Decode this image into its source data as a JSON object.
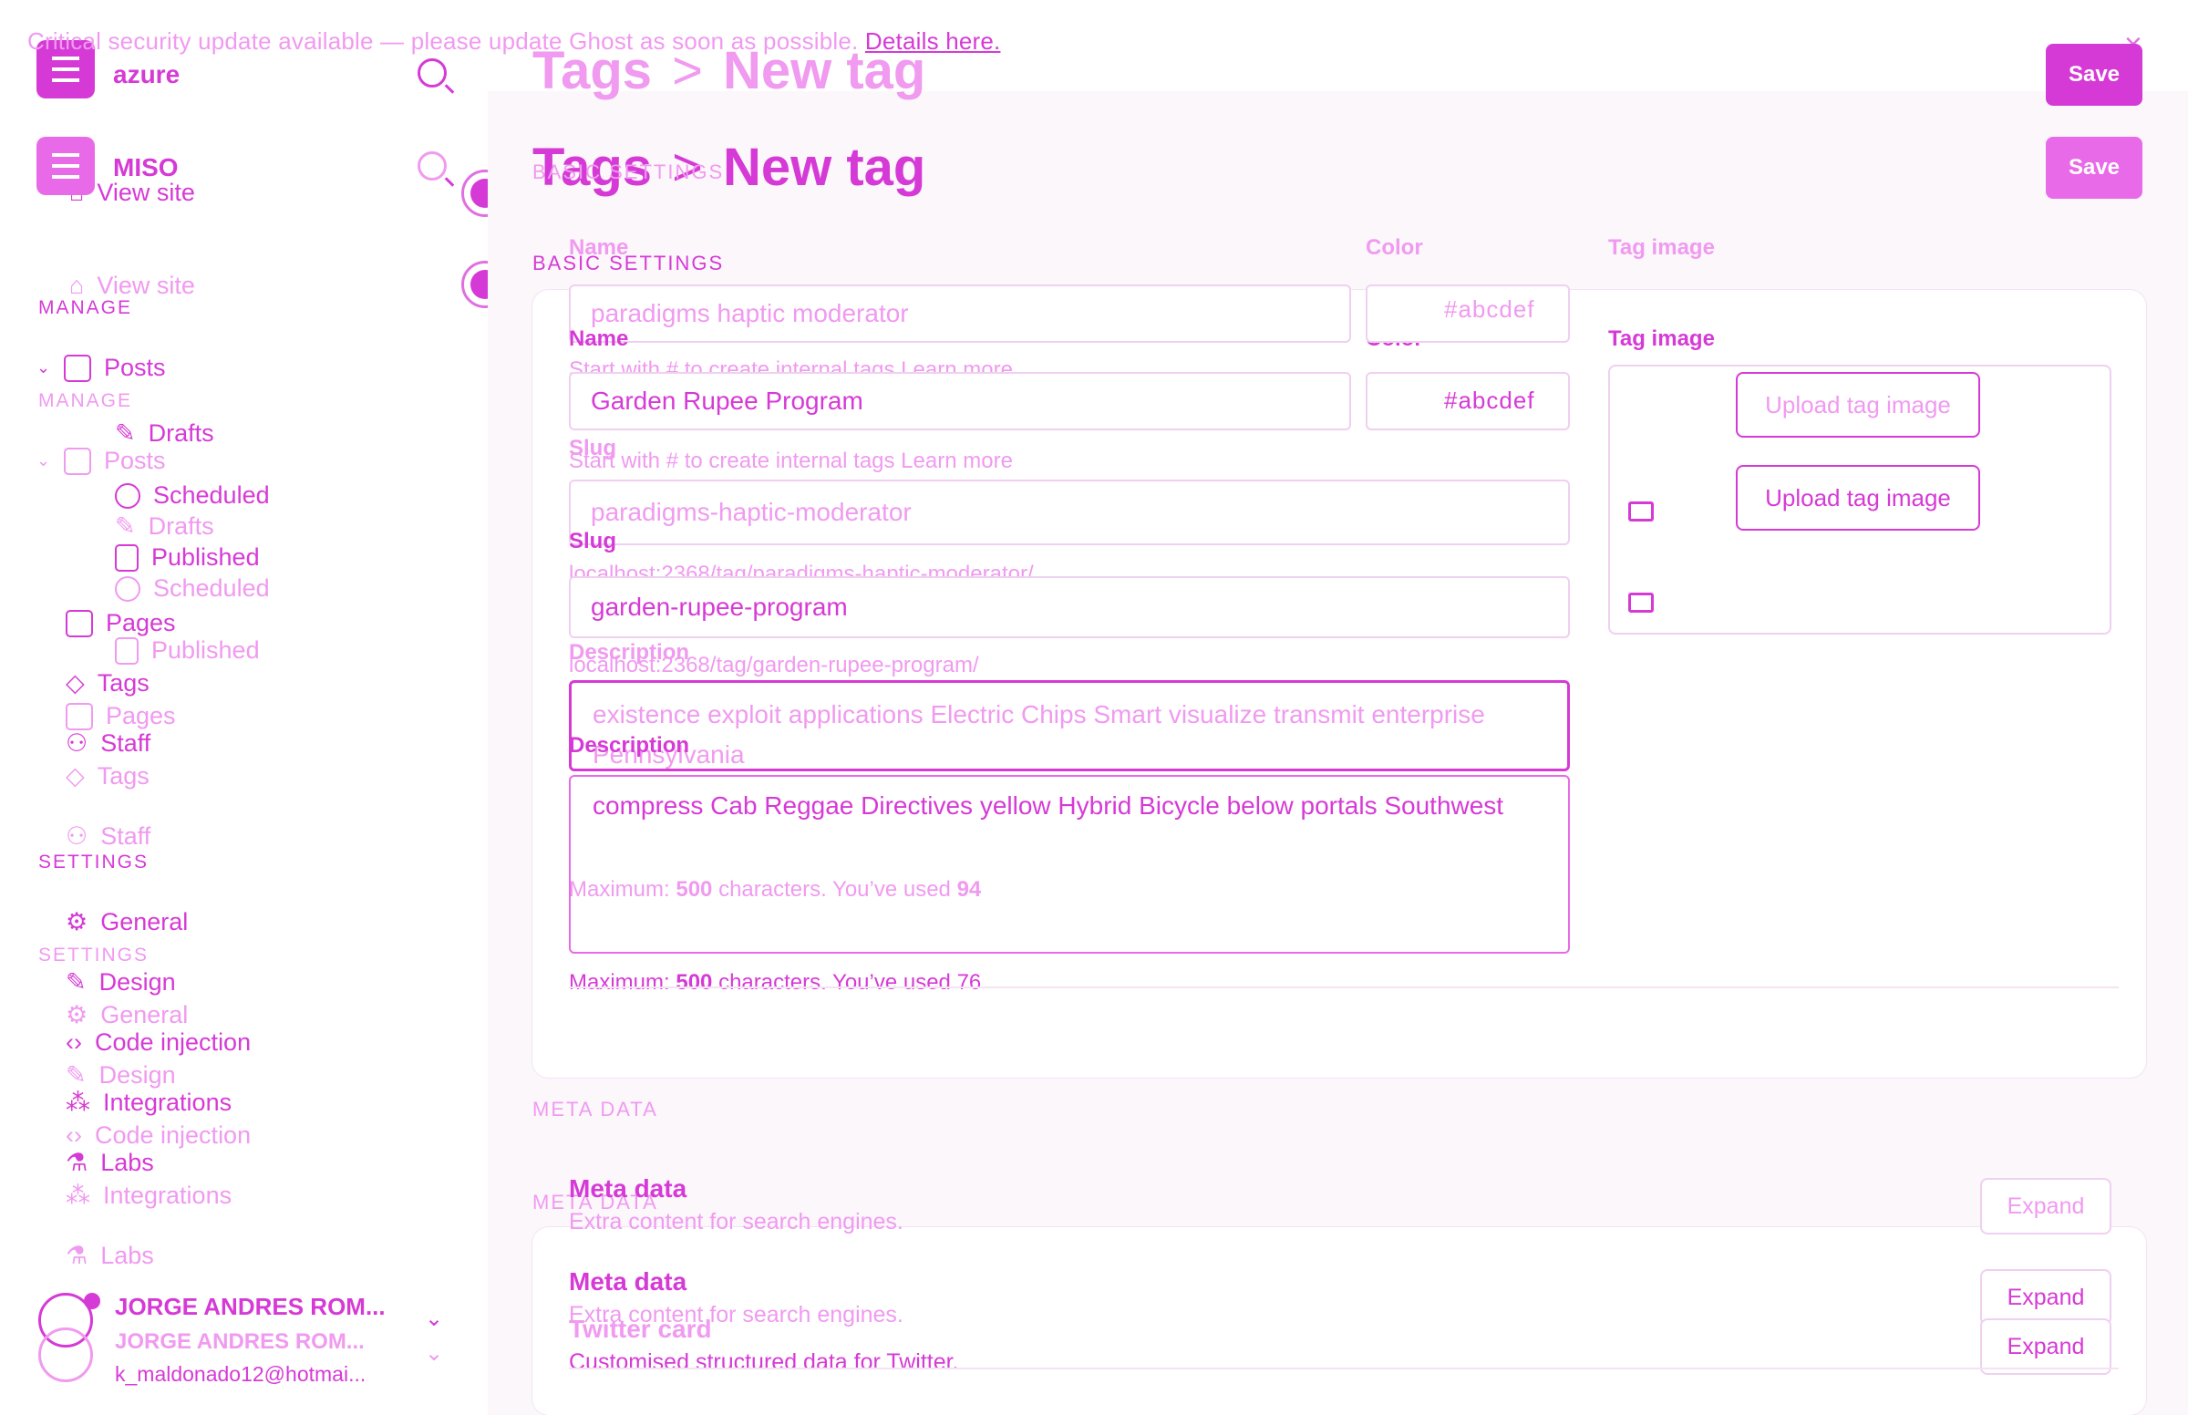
{
  "banner": {
    "text": "Critical security update available — please update Ghost as soon as possible.",
    "link": "Details here.",
    "close": "×"
  },
  "sidebar": {
    "brand_a": "azure",
    "brand_b": "MISO",
    "view_site": "View site",
    "manage_heading": "MANAGE",
    "settings_heading": "SETTINGS",
    "nav": {
      "posts": "Posts",
      "drafts": "Drafts",
      "scheduled": "Scheduled",
      "published": "Published",
      "pages": "Pages",
      "tags": "Tags",
      "staff": "Staff",
      "general": "General",
      "design": "Design",
      "code_injection": "Code injection",
      "integrations": "Integrations",
      "labs": "Labs"
    },
    "user": {
      "name": "JORGE ANDRES ROM...",
      "email": "k_maldonado12@hotmai..."
    }
  },
  "header": {
    "crumb": "Tags",
    "separator": ">",
    "title": "New tag",
    "save_label": "Save"
  },
  "basic": {
    "heading": "BASIC SETTINGS",
    "name_label": "Name",
    "color_label": "Color",
    "image_label": "Tag image",
    "name_value_a": "paradigms haptic moderator",
    "name_value_b": "Garden Rupee Program",
    "name_hint": "Start with # to create internal tags Learn more",
    "color_value": "#abcdef",
    "slug_label": "Slug",
    "slug_value_a": "paradigms-haptic-moderator",
    "slug_value_b": "garden-rupee-program",
    "slug_url_a": "localhost:2368/tag/paradigms-haptic-moderator/",
    "slug_url_b": "localhost:2368/tag/garden-rupee-program/",
    "description_label": "Description",
    "description_a": "existence exploit applications Electric Chips Smart visualize transmit enterprise Pennsylvania",
    "description_b": "compress Cab Reggae Directives yellow Hybrid Bicycle below portals Southwest",
    "max_prefix": "Maximum:",
    "max_value": "500",
    "max_mid": "characters. You’ve used",
    "used_a": "94",
    "used_b": "76",
    "upload_label": "Upload tag image"
  },
  "meta": {
    "heading": "META DATA",
    "meta_title": "Meta data",
    "meta_sub": "Extra content for search engines.",
    "twitter_title": "Twitter card",
    "twitter_sub": "Customised structured data for Twitter.",
    "expand_label": "Expand"
  }
}
